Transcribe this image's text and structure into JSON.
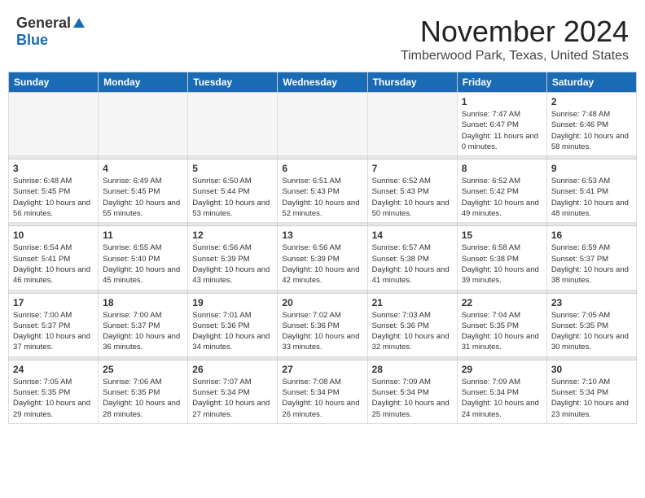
{
  "header": {
    "logo_general": "General",
    "logo_blue": "Blue",
    "month_title": "November 2024",
    "location": "Timberwood Park, Texas, United States"
  },
  "weekdays": [
    "Sunday",
    "Monday",
    "Tuesday",
    "Wednesday",
    "Thursday",
    "Friday",
    "Saturday"
  ],
  "weeks": [
    [
      {
        "day": "",
        "info": ""
      },
      {
        "day": "",
        "info": ""
      },
      {
        "day": "",
        "info": ""
      },
      {
        "day": "",
        "info": ""
      },
      {
        "day": "",
        "info": ""
      },
      {
        "day": "1",
        "info": "Sunrise: 7:47 AM\nSunset: 6:47 PM\nDaylight: 11 hours and 0 minutes."
      },
      {
        "day": "2",
        "info": "Sunrise: 7:48 AM\nSunset: 6:46 PM\nDaylight: 10 hours and 58 minutes."
      }
    ],
    [
      {
        "day": "3",
        "info": "Sunrise: 6:48 AM\nSunset: 5:45 PM\nDaylight: 10 hours and 56 minutes."
      },
      {
        "day": "4",
        "info": "Sunrise: 6:49 AM\nSunset: 5:45 PM\nDaylight: 10 hours and 55 minutes."
      },
      {
        "day": "5",
        "info": "Sunrise: 6:50 AM\nSunset: 5:44 PM\nDaylight: 10 hours and 53 minutes."
      },
      {
        "day": "6",
        "info": "Sunrise: 6:51 AM\nSunset: 5:43 PM\nDaylight: 10 hours and 52 minutes."
      },
      {
        "day": "7",
        "info": "Sunrise: 6:52 AM\nSunset: 5:43 PM\nDaylight: 10 hours and 50 minutes."
      },
      {
        "day": "8",
        "info": "Sunrise: 6:52 AM\nSunset: 5:42 PM\nDaylight: 10 hours and 49 minutes."
      },
      {
        "day": "9",
        "info": "Sunrise: 6:53 AM\nSunset: 5:41 PM\nDaylight: 10 hours and 48 minutes."
      }
    ],
    [
      {
        "day": "10",
        "info": "Sunrise: 6:54 AM\nSunset: 5:41 PM\nDaylight: 10 hours and 46 minutes."
      },
      {
        "day": "11",
        "info": "Sunrise: 6:55 AM\nSunset: 5:40 PM\nDaylight: 10 hours and 45 minutes."
      },
      {
        "day": "12",
        "info": "Sunrise: 6:56 AM\nSunset: 5:39 PM\nDaylight: 10 hours and 43 minutes."
      },
      {
        "day": "13",
        "info": "Sunrise: 6:56 AM\nSunset: 5:39 PM\nDaylight: 10 hours and 42 minutes."
      },
      {
        "day": "14",
        "info": "Sunrise: 6:57 AM\nSunset: 5:38 PM\nDaylight: 10 hours and 41 minutes."
      },
      {
        "day": "15",
        "info": "Sunrise: 6:58 AM\nSunset: 5:38 PM\nDaylight: 10 hours and 39 minutes."
      },
      {
        "day": "16",
        "info": "Sunrise: 6:59 AM\nSunset: 5:37 PM\nDaylight: 10 hours and 38 minutes."
      }
    ],
    [
      {
        "day": "17",
        "info": "Sunrise: 7:00 AM\nSunset: 5:37 PM\nDaylight: 10 hours and 37 minutes."
      },
      {
        "day": "18",
        "info": "Sunrise: 7:00 AM\nSunset: 5:37 PM\nDaylight: 10 hours and 36 minutes."
      },
      {
        "day": "19",
        "info": "Sunrise: 7:01 AM\nSunset: 5:36 PM\nDaylight: 10 hours and 34 minutes."
      },
      {
        "day": "20",
        "info": "Sunrise: 7:02 AM\nSunset: 5:36 PM\nDaylight: 10 hours and 33 minutes."
      },
      {
        "day": "21",
        "info": "Sunrise: 7:03 AM\nSunset: 5:36 PM\nDaylight: 10 hours and 32 minutes."
      },
      {
        "day": "22",
        "info": "Sunrise: 7:04 AM\nSunset: 5:35 PM\nDaylight: 10 hours and 31 minutes."
      },
      {
        "day": "23",
        "info": "Sunrise: 7:05 AM\nSunset: 5:35 PM\nDaylight: 10 hours and 30 minutes."
      }
    ],
    [
      {
        "day": "24",
        "info": "Sunrise: 7:05 AM\nSunset: 5:35 PM\nDaylight: 10 hours and 29 minutes."
      },
      {
        "day": "25",
        "info": "Sunrise: 7:06 AM\nSunset: 5:35 PM\nDaylight: 10 hours and 28 minutes."
      },
      {
        "day": "26",
        "info": "Sunrise: 7:07 AM\nSunset: 5:34 PM\nDaylight: 10 hours and 27 minutes."
      },
      {
        "day": "27",
        "info": "Sunrise: 7:08 AM\nSunset: 5:34 PM\nDaylight: 10 hours and 26 minutes."
      },
      {
        "day": "28",
        "info": "Sunrise: 7:09 AM\nSunset: 5:34 PM\nDaylight: 10 hours and 25 minutes."
      },
      {
        "day": "29",
        "info": "Sunrise: 7:09 AM\nSunset: 5:34 PM\nDaylight: 10 hours and 24 minutes."
      },
      {
        "day": "30",
        "info": "Sunrise: 7:10 AM\nSunset: 5:34 PM\nDaylight: 10 hours and 23 minutes."
      }
    ]
  ]
}
